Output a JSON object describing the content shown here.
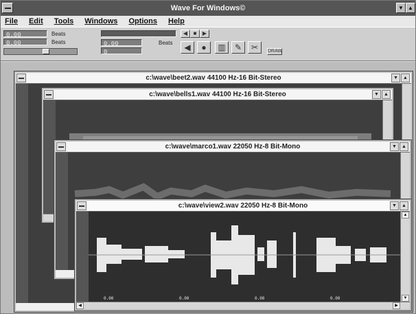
{
  "app": {
    "title": "Wave For Windows©",
    "menus": [
      "File",
      "Edit",
      "Tools",
      "Windows",
      "Options",
      "Help"
    ]
  },
  "toolbar": {
    "lcd1_top": "0.00",
    "lcd1_bottom": "0.00",
    "lcd1_top_unit": "Beats",
    "lcd1_bottom_unit": "Beats",
    "lcd2_value": "0.00",
    "lcd2_sub": "0",
    "lcd2_unit": "Beats",
    "small_button_label": "DRAW"
  },
  "windows": [
    {
      "title": "c:\\wave\\beet2.wav   44100 Hz-16 Bit-Stereo"
    },
    {
      "title": "c:\\wave\\bells1.wav   44100 Hz-16 Bit-Stereo"
    },
    {
      "title": "c:\\wave\\marco1.wav   22050 Hz-8 Bit-Mono"
    },
    {
      "title": "c:\\wave\\view2.wav   22050 Hz-8 Bit-Mono",
      "time_labels": [
        "0.00",
        "0.00",
        "0.00",
        "0.00"
      ]
    }
  ]
}
